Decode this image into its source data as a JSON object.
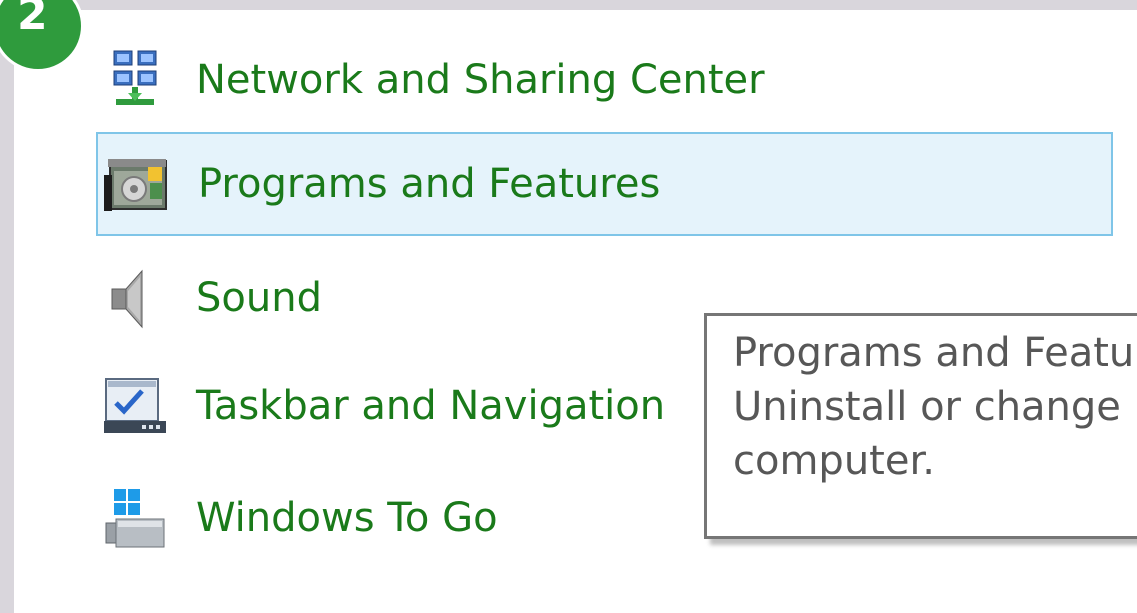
{
  "step": {
    "number": "2",
    "color": "#2f9b3d"
  },
  "items": [
    {
      "label": "Network and Sharing Center",
      "icon": "network-icon",
      "selected": false
    },
    {
      "label": "Programs and Features",
      "icon": "programs-icon",
      "selected": true
    },
    {
      "label": "Sound",
      "icon": "speaker-icon",
      "selected": false
    },
    {
      "label": "Taskbar and Navigation",
      "icon": "taskbar-icon",
      "selected": false
    },
    {
      "label": "Windows To Go",
      "icon": "windows-to-go-icon",
      "selected": false
    }
  ],
  "tooltip": {
    "title": "Programs and Features",
    "line2": "Uninstall or change programs on your",
    "line3": "computer."
  },
  "colors": {
    "label_green": "#1a7a1a",
    "selection_bg": "#e5f3fb",
    "selection_border": "#7fc5e8"
  }
}
